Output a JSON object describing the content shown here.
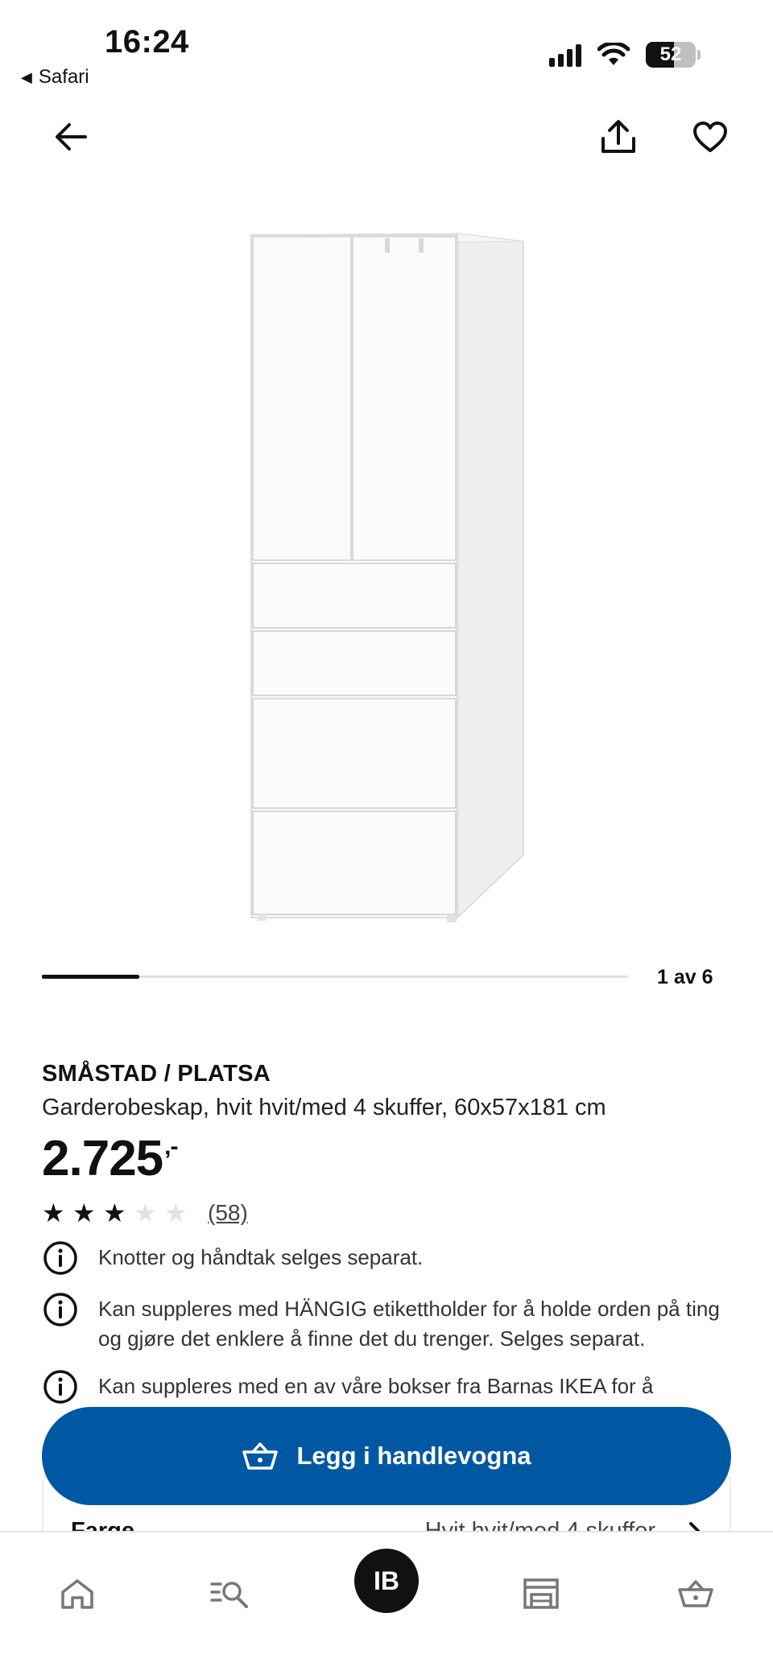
{
  "status_bar": {
    "time": "16:24",
    "back_app": "Safari",
    "battery": "52"
  },
  "nav": {
    "back_icon": "arrow-left-icon",
    "share_icon": "share-icon",
    "favorite_icon": "heart-icon"
  },
  "gallery": {
    "counter": "1 av 6",
    "progress": 0.1667
  },
  "product": {
    "brand": "SMÅSTAD / PLATSA",
    "description": "Garderobeskap, hvit hvit/med 4 skuffer, 60x57x181 cm",
    "price": "2.725",
    "price_suffix": ",-",
    "rating_stars": 3,
    "rating_max": 5,
    "review_count": "(58)"
  },
  "notes": [
    {
      "text": "Knotter og håndtak selges separat."
    },
    {
      "text": "Kan suppleres med HÄNGIG etikettholder for å holde orden på ting og gjøre det enklere å finne det du trenger. Selges separat."
    },
    {
      "text": "Kan suppleres med en av våre bokser fra Barnas IKEA for å"
    }
  ],
  "cta": {
    "label": "Legg i handlevogna"
  },
  "peek_row": {
    "label": "Farge",
    "value": "Hvit hvit/med 4 skuffer"
  },
  "tab_bar": {
    "profile_initials": "IB"
  },
  "colors": {
    "accent": "#0058a3",
    "text": "#111111"
  }
}
